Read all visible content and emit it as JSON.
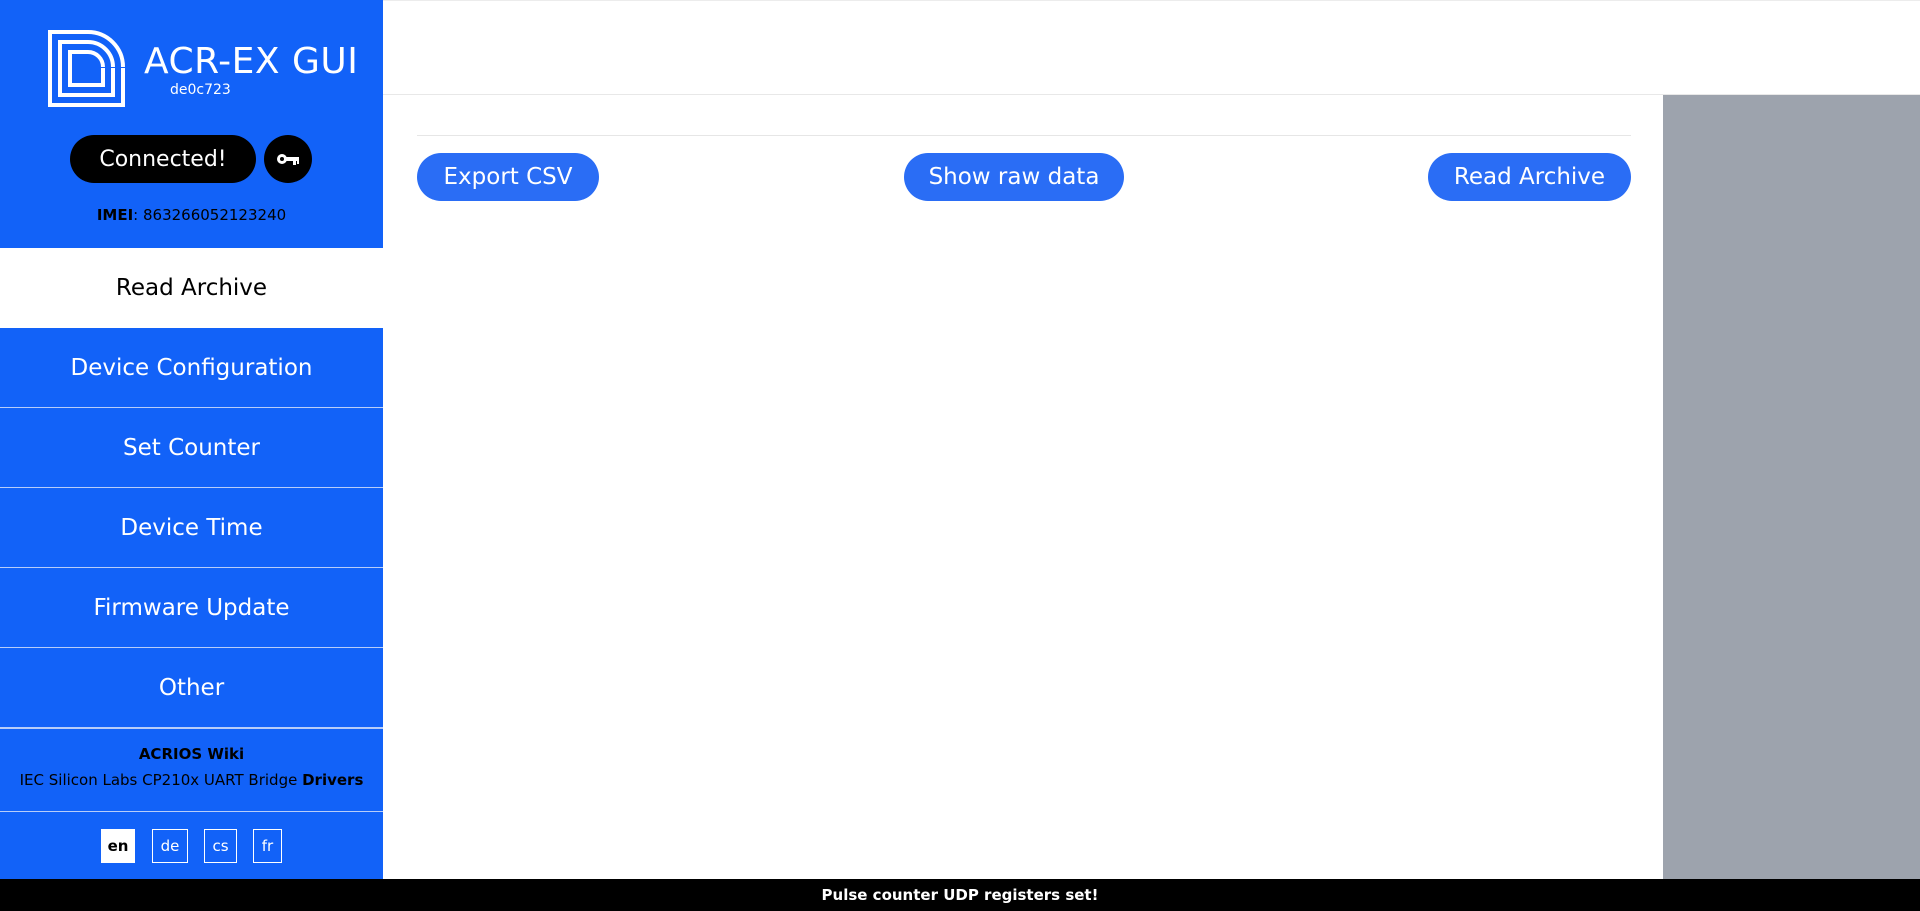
{
  "app": {
    "title": "ACR-EX GUI",
    "version": "de0c723",
    "logo_icon": "acrios-logo-icon"
  },
  "connection": {
    "status_label": "Connected!",
    "key_icon": "key-icon",
    "imei_label": "IMEI",
    "imei_value": "863266052123240"
  },
  "sidebar": {
    "items": [
      {
        "label": "Read Archive",
        "active": true
      },
      {
        "label": "Device Configuration",
        "active": false
      },
      {
        "label": "Set Counter",
        "active": false
      },
      {
        "label": "Device Time",
        "active": false
      },
      {
        "label": "Firmware Update",
        "active": false
      },
      {
        "label": "Other",
        "active": false
      }
    ],
    "footer": {
      "wiki_label": "ACRIOS Wiki",
      "drivers_text": "IEC Silicon Labs CP210x UART Bridge",
      "drivers_link": "Drivers"
    },
    "languages": [
      {
        "code": "en",
        "active": true
      },
      {
        "code": "de",
        "active": false
      },
      {
        "code": "cs",
        "active": false
      },
      {
        "code": "fr",
        "active": false
      }
    ]
  },
  "main": {
    "buttons": {
      "export_csv": "Export CSV",
      "show_raw": "Show raw data",
      "read_archive": "Read Archive"
    }
  },
  "status_bar": {
    "message": "Pulse counter UDP registers set!"
  },
  "colors": {
    "sidebar": "#1262f8",
    "button": "#2a6df5",
    "right_panel": "#9da3ad",
    "status_bar": "#000000"
  }
}
